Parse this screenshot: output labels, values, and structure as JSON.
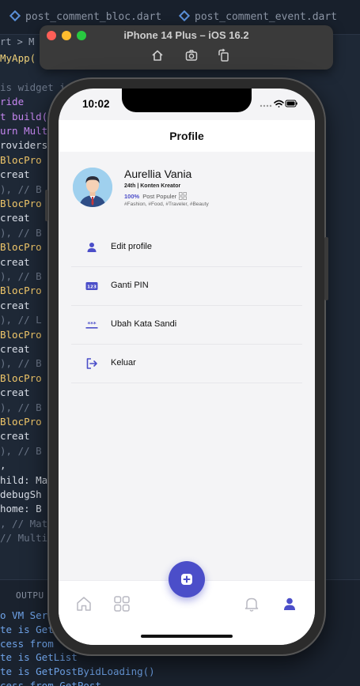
{
  "ide": {
    "tabs": [
      "post_comment_bloc.dart",
      "post_comment_event.dart"
    ],
    "breadcrumb": "rt > M",
    "code_lines": [
      {
        "text": "MyApp(",
        "kind": "fn"
      },
      {
        "text": "",
        "kind": "tx"
      },
      {
        "text": "is widget i",
        "kind": "cm"
      },
      {
        "text": "ride",
        "kind": "kw"
      },
      {
        "text": "t build(",
        "kind": "kw"
      },
      {
        "text": "urn Multi",
        "kind": "kw"
      },
      {
        "text": "roviders",
        "kind": "tx"
      },
      {
        "text": "BlocPro",
        "kind": "cls"
      },
      {
        "text": "  creat",
        "kind": "tx"
      },
      {
        "text": "), // B",
        "kind": "cm"
      },
      {
        "text": "BlocPro",
        "kind": "cls"
      },
      {
        "text": "  creat",
        "kind": "tx"
      },
      {
        "text": "), // B",
        "kind": "cm"
      },
      {
        "text": "BlocPro",
        "kind": "cls"
      },
      {
        "text": "  creat",
        "kind": "tx"
      },
      {
        "text": "), // B",
        "kind": "cm"
      },
      {
        "text": "BlocPro",
        "kind": "cls"
      },
      {
        "text": "  creat",
        "kind": "tx"
      },
      {
        "text": "), // L",
        "kind": "cm"
      },
      {
        "text": "BlocPro",
        "kind": "cls"
      },
      {
        "text": "  creat",
        "kind": "tx"
      },
      {
        "text": "), // B",
        "kind": "cm"
      },
      {
        "text": "BlocPro",
        "kind": "cls"
      },
      {
        "text": "  creat",
        "kind": "tx"
      },
      {
        "text": "), // B",
        "kind": "cm"
      },
      {
        "text": "BlocPro",
        "kind": "cls"
      },
      {
        "text": "  creat",
        "kind": "tx"
      },
      {
        "text": "), // B",
        "kind": "cm"
      },
      {
        "text": ",",
        "kind": "tx"
      },
      {
        "text": "hild: Ma",
        "kind": "tx"
      },
      {
        "text": " debugSh",
        "kind": "tx"
      },
      {
        "text": " home: B",
        "kind": "tx"
      },
      {
        "text": ", // Mat",
        "kind": "cm"
      },
      {
        "text": "// Multi",
        "kind": "cm"
      }
    ],
    "output_tab": "OUTPU",
    "output_lines": [
      "o VM Serv",
      "te is Get",
      "cess from",
      "te is GetList",
      "te is GetPostByidLoading()",
      "cess from GetPost"
    ]
  },
  "simulator": {
    "title": "iPhone 14 Plus – iOS 16.2",
    "buttons": [
      "home-icon",
      "screenshot-icon",
      "rotate-icon"
    ]
  },
  "status_bar": {
    "time": "10:02"
  },
  "app": {
    "title": "Profile",
    "profile": {
      "name": "Aurellia Vania",
      "meta": "24th | Konten Kreator",
      "popularity_percent": "100%",
      "popularity_label": "Post Populer",
      "tags": "#Fashion, #Food, #Traveler, #Beauty"
    },
    "menu": [
      {
        "label": "Edit profile",
        "icon": "person-icon"
      },
      {
        "label": "Ganti PIN",
        "icon": "pin-123-icon"
      },
      {
        "label": "Ubah Kata Sandi",
        "icon": "password-icon"
      },
      {
        "label": "Keluar",
        "icon": "logout-icon"
      }
    ],
    "bottom_nav": [
      "home-icon",
      "grid-icon",
      "add-icon",
      "bell-icon",
      "profile-icon"
    ],
    "colors": {
      "accent": "#4b4ec9",
      "background": "#f4f4f6",
      "text": "#111111"
    }
  }
}
